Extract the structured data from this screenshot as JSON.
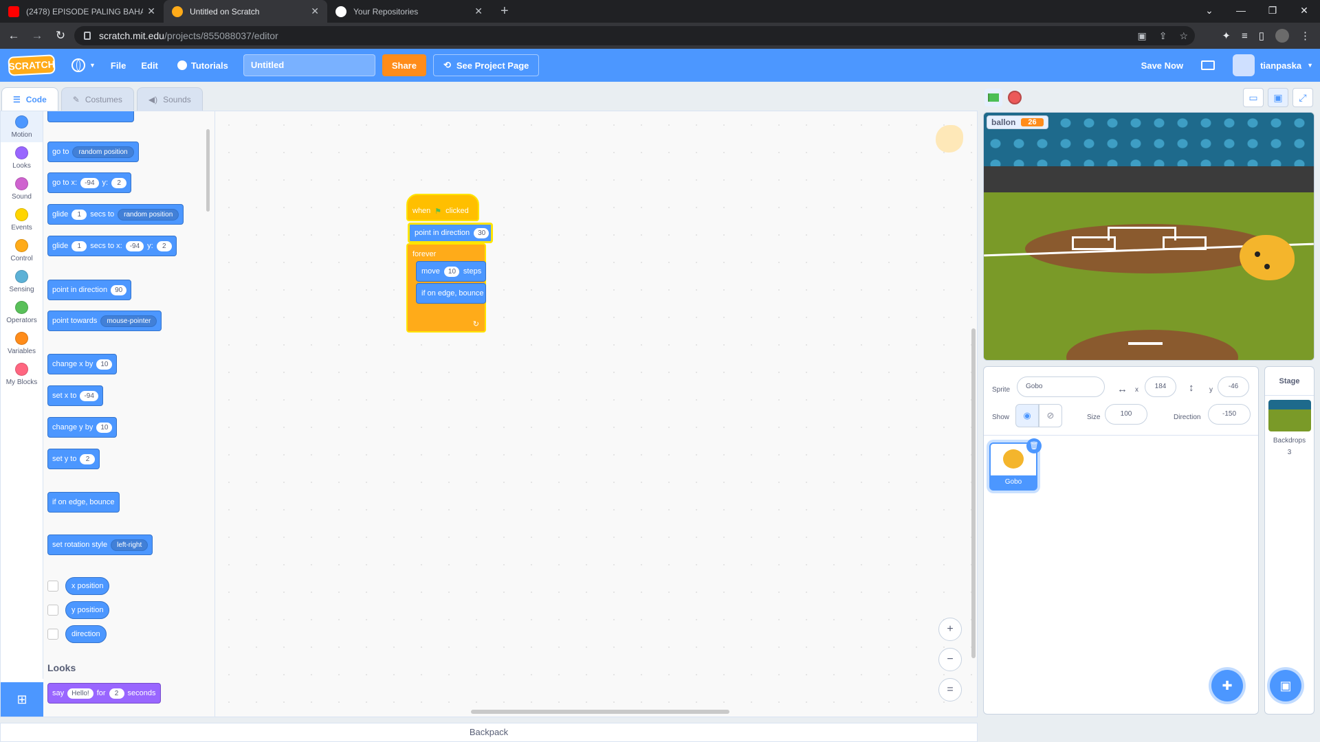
{
  "browser": {
    "tabs": [
      {
        "title": "(2478) EPISODE PALING BAHAYA",
        "favicon_color": "#ff0000"
      },
      {
        "title": "Untitled on Scratch",
        "favicon_color": "#ffab19"
      },
      {
        "title": "Your Repositories",
        "favicon_color": "#ffffff"
      }
    ],
    "url_host": "scratch.mit.edu",
    "url_path": "/projects/855088037/editor"
  },
  "menubar": {
    "logo": "SCRATCH",
    "file": "File",
    "edit": "Edit",
    "tutorials": "Tutorials",
    "project_title": "Untitled",
    "share": "Share",
    "see_project_page": "See Project Page",
    "save_now": "Save Now",
    "username": "tianpaska"
  },
  "tabs": {
    "code": "Code",
    "costumes": "Costumes",
    "sounds": "Sounds"
  },
  "categories": [
    {
      "label": "Motion",
      "color": "#4c97ff"
    },
    {
      "label": "Looks",
      "color": "#9966ff"
    },
    {
      "label": "Sound",
      "color": "#cf63cf"
    },
    {
      "label": "Events",
      "color": "#ffd500"
    },
    {
      "label": "Control",
      "color": "#ffab19"
    },
    {
      "label": "Sensing",
      "color": "#5cb1d6"
    },
    {
      "label": "Operators",
      "color": "#59c059"
    },
    {
      "label": "Variables",
      "color": "#ff8c1a"
    },
    {
      "label": "My Blocks",
      "color": "#ff6680"
    }
  ],
  "palette": {
    "goto_label": "go to",
    "goto_dd": "random position",
    "gotoxy_label": "go to x:",
    "gotoxy_x": "-94",
    "gotoxy_y_label": "y:",
    "gotoxy_y": "2",
    "glide1_label": "glide",
    "glide1_secs": "1",
    "glide1_mid": "secs to",
    "glide1_dd": "random position",
    "glide2_label": "glide",
    "glide2_secs": "1",
    "glide2_mid": "secs to x:",
    "glide2_x": "-94",
    "glide2_y_label": "y:",
    "glide2_y": "2",
    "pointdir_label": "point in direction",
    "pointdir_val": "90",
    "pointtow_label": "point towards",
    "pointtow_dd": "mouse-pointer",
    "changex_label": "change x by",
    "changex_val": "10",
    "setx_label": "set x to",
    "setx_val": "-94",
    "changey_label": "change y by",
    "changey_val": "10",
    "sety_label": "set y to",
    "sety_val": "2",
    "bounce_label": "if on edge, bounce",
    "rotstyle_label": "set rotation style",
    "rotstyle_dd": "left-right",
    "xpos": "x position",
    "ypos": "y position",
    "direction": "direction",
    "looks_header": "Looks",
    "say_label": "say",
    "say_text": "Hello!",
    "say_for": "for",
    "say_secs": "2",
    "say_unit": "seconds"
  },
  "script": {
    "hat_when": "when",
    "hat_clicked": "clicked",
    "point_label": "point in direction",
    "point_val": "30",
    "forever": "forever",
    "move_label": "move",
    "move_val": "10",
    "move_unit": "steps",
    "bounce": "if on edge, bounce"
  },
  "workspace": {
    "zoom_in": "+",
    "zoom_out": "−",
    "zoom_reset": "="
  },
  "backpack": "Backpack",
  "stage": {
    "monitor_label": "ballon",
    "monitor_value": "26"
  },
  "sprite_info": {
    "sprite_label": "Sprite",
    "sprite_name": "Gobo",
    "x_label": "x",
    "x_val": "184",
    "y_label": "y",
    "y_val": "-46",
    "show_label": "Show",
    "size_label": "Size",
    "size_val": "100",
    "direction_label": "Direction",
    "direction_val": "-150"
  },
  "sprites": [
    {
      "name": "Gobo"
    }
  ],
  "stage_pane": {
    "title": "Stage",
    "backdrops_label": "Backdrops",
    "backdrops_count": "3"
  },
  "colors": {
    "motion": "#4c97ff",
    "looks": "#9966ff",
    "events": "#ffbf00",
    "control": "#ffab19",
    "menubar": "#4c97ff",
    "share": "#ff8c1a"
  }
}
